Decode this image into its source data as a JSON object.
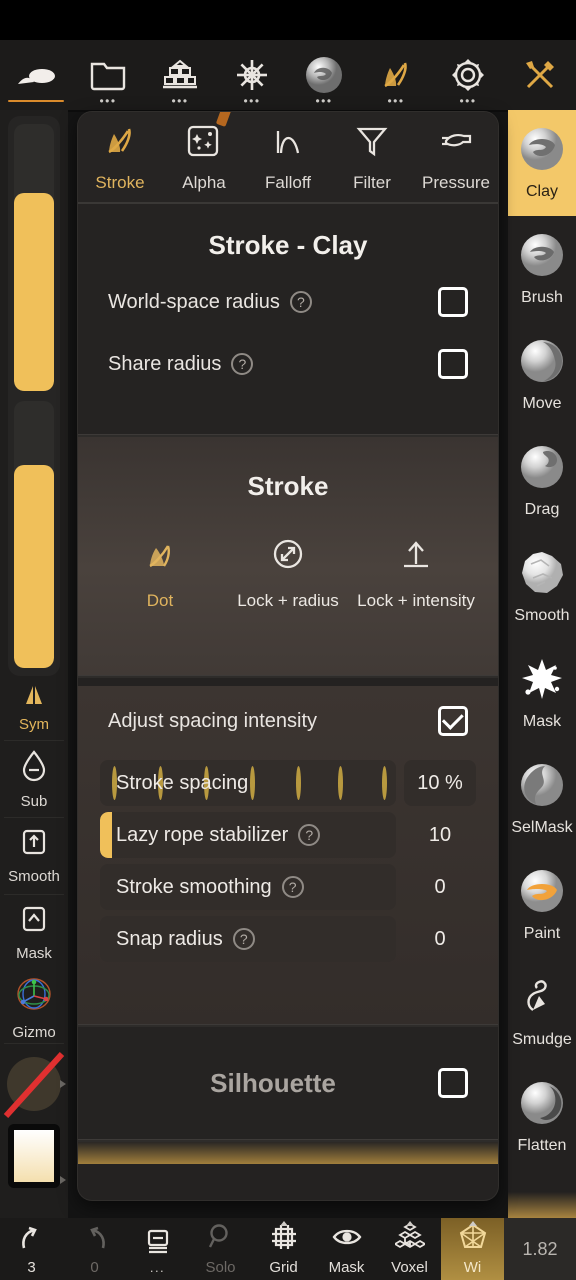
{
  "toolbar": {
    "items": [
      {
        "name": "scene",
        "icon": "shape-icon",
        "dots": false,
        "active": true
      },
      {
        "name": "files",
        "icon": "folder-icon",
        "dots": true,
        "active": false
      },
      {
        "name": "topology",
        "icon": "stack-icon",
        "dots": true,
        "active": false
      },
      {
        "name": "lighting",
        "icon": "sun-icon",
        "dots": true,
        "active": false
      },
      {
        "name": "material",
        "icon": "sphere-icon",
        "dots": true,
        "active": false
      },
      {
        "name": "brush",
        "icon": "brush-icon",
        "dots": true,
        "active": false
      },
      {
        "name": "settings",
        "icon": "gear-icon",
        "dots": true,
        "active": false
      },
      {
        "name": "tools",
        "icon": "wrench-cross-icon",
        "dots": false,
        "active": false
      }
    ]
  },
  "left_rail": {
    "slider_top_fill_pct": 74,
    "slider_bottom_fill_pct": 76,
    "sym_label": "Sym",
    "buttons": [
      {
        "label": "Sub",
        "icon": "droplet-minus-icon"
      },
      {
        "label": "Smooth",
        "icon": "square-up-arrow-icon"
      },
      {
        "label": "Mask",
        "icon": "square-caret-up-icon"
      },
      {
        "label": "Gizmo",
        "icon": "gizmo-icon"
      }
    ]
  },
  "panel": {
    "tabs": [
      {
        "label": "Stroke",
        "icon": "brush-icon",
        "active": true
      },
      {
        "label": "Alpha",
        "icon": "alpha-square-icon",
        "active": false
      },
      {
        "label": "Falloff",
        "icon": "curve-icon",
        "active": false
      },
      {
        "label": "Filter",
        "icon": "funnel-icon",
        "active": false
      },
      {
        "label": "Pressure",
        "icon": "pressure-hand-icon",
        "active": false
      }
    ],
    "header": {
      "title": "Stroke - Clay",
      "options": [
        {
          "label": "World-space radius",
          "help": "?",
          "checked": false
        },
        {
          "label": "Share radius",
          "help": "?",
          "checked": false
        }
      ]
    },
    "stroke": {
      "title": "Stroke",
      "modes": [
        {
          "label": "Dot",
          "icon": "brush-dot-icon",
          "active": true
        },
        {
          "label": "Lock + radius",
          "icon": "circle-resize-icon",
          "active": false
        },
        {
          "label": "Lock + intensity",
          "icon": "up-arrow-line-icon",
          "active": false
        }
      ]
    },
    "spacing": {
      "toggle_label": "Adjust spacing intensity",
      "toggle_checked": true,
      "sliders": [
        {
          "label": "Stroke spacing",
          "help": null,
          "value": "10 %",
          "fill_pct": 0,
          "boxed": true,
          "ticks": true
        },
        {
          "label": "Lazy rope stabilizer",
          "help": "?",
          "value": "10",
          "fill_pct": 4,
          "boxed": false,
          "ticks": false
        },
        {
          "label": "Stroke smoothing",
          "help": "?",
          "value": "0",
          "fill_pct": 0,
          "boxed": false,
          "ticks": false
        },
        {
          "label": "Snap radius",
          "help": "?",
          "value": "0",
          "fill_pct": 0,
          "boxed": false,
          "ticks": false
        }
      ]
    },
    "silhouette": {
      "title": "Silhouette",
      "checked": false
    }
  },
  "right_rail": {
    "tools": [
      {
        "label": "Clay",
        "icon": "clay-sphere-icon",
        "active": true
      },
      {
        "label": "Brush",
        "icon": "brush-sphere-icon",
        "active": false
      },
      {
        "label": "Move",
        "icon": "move-sphere-icon",
        "active": false
      },
      {
        "label": "Drag",
        "icon": "drag-sphere-icon",
        "active": false
      },
      {
        "label": "Smooth",
        "icon": "smooth-sphere-icon",
        "active": false
      },
      {
        "label": "Mask",
        "icon": "mask-splat-icon",
        "active": false
      },
      {
        "label": "SelMask",
        "icon": "selmask-sphere-icon",
        "active": false
      },
      {
        "label": "Paint",
        "icon": "paint-sphere-icon",
        "active": false
      },
      {
        "label": "Smudge",
        "icon": "smudge-hand-icon",
        "active": false
      },
      {
        "label": "Flatten",
        "icon": "flatten-sphere-icon",
        "active": false
      }
    ]
  },
  "bottom_bar": {
    "items": [
      {
        "label": "3",
        "icon": "undo-icon",
        "dim": false,
        "caret": false,
        "highlight": false
      },
      {
        "label": "0",
        "icon": "redo-icon",
        "dim": true,
        "caret": false,
        "highlight": false
      },
      {
        "label": "...",
        "icon": "layers-icon",
        "dim": false,
        "caret": false,
        "highlight": false
      },
      {
        "label": "Solo",
        "icon": "magnifier-icon",
        "dim": true,
        "caret": false,
        "highlight": false
      },
      {
        "label": "Grid",
        "icon": "grid-frame-icon",
        "dim": false,
        "caret": true,
        "highlight": false
      },
      {
        "label": "Mask",
        "icon": "eye-icon",
        "dim": false,
        "caret": false,
        "highlight": false
      },
      {
        "label": "Voxel",
        "icon": "voxel-cubes-icon",
        "dim": false,
        "caret": true,
        "highlight": false
      },
      {
        "label": "Wi",
        "icon": "wireframe-icon",
        "dim": false,
        "caret": true,
        "highlight": true
      }
    ],
    "version": "1.82"
  },
  "colors": {
    "accent_gold": "#f0c05a",
    "accent_orange": "#d98a2b",
    "panel_bg": "#242221",
    "warm_section": "#4a423d"
  }
}
